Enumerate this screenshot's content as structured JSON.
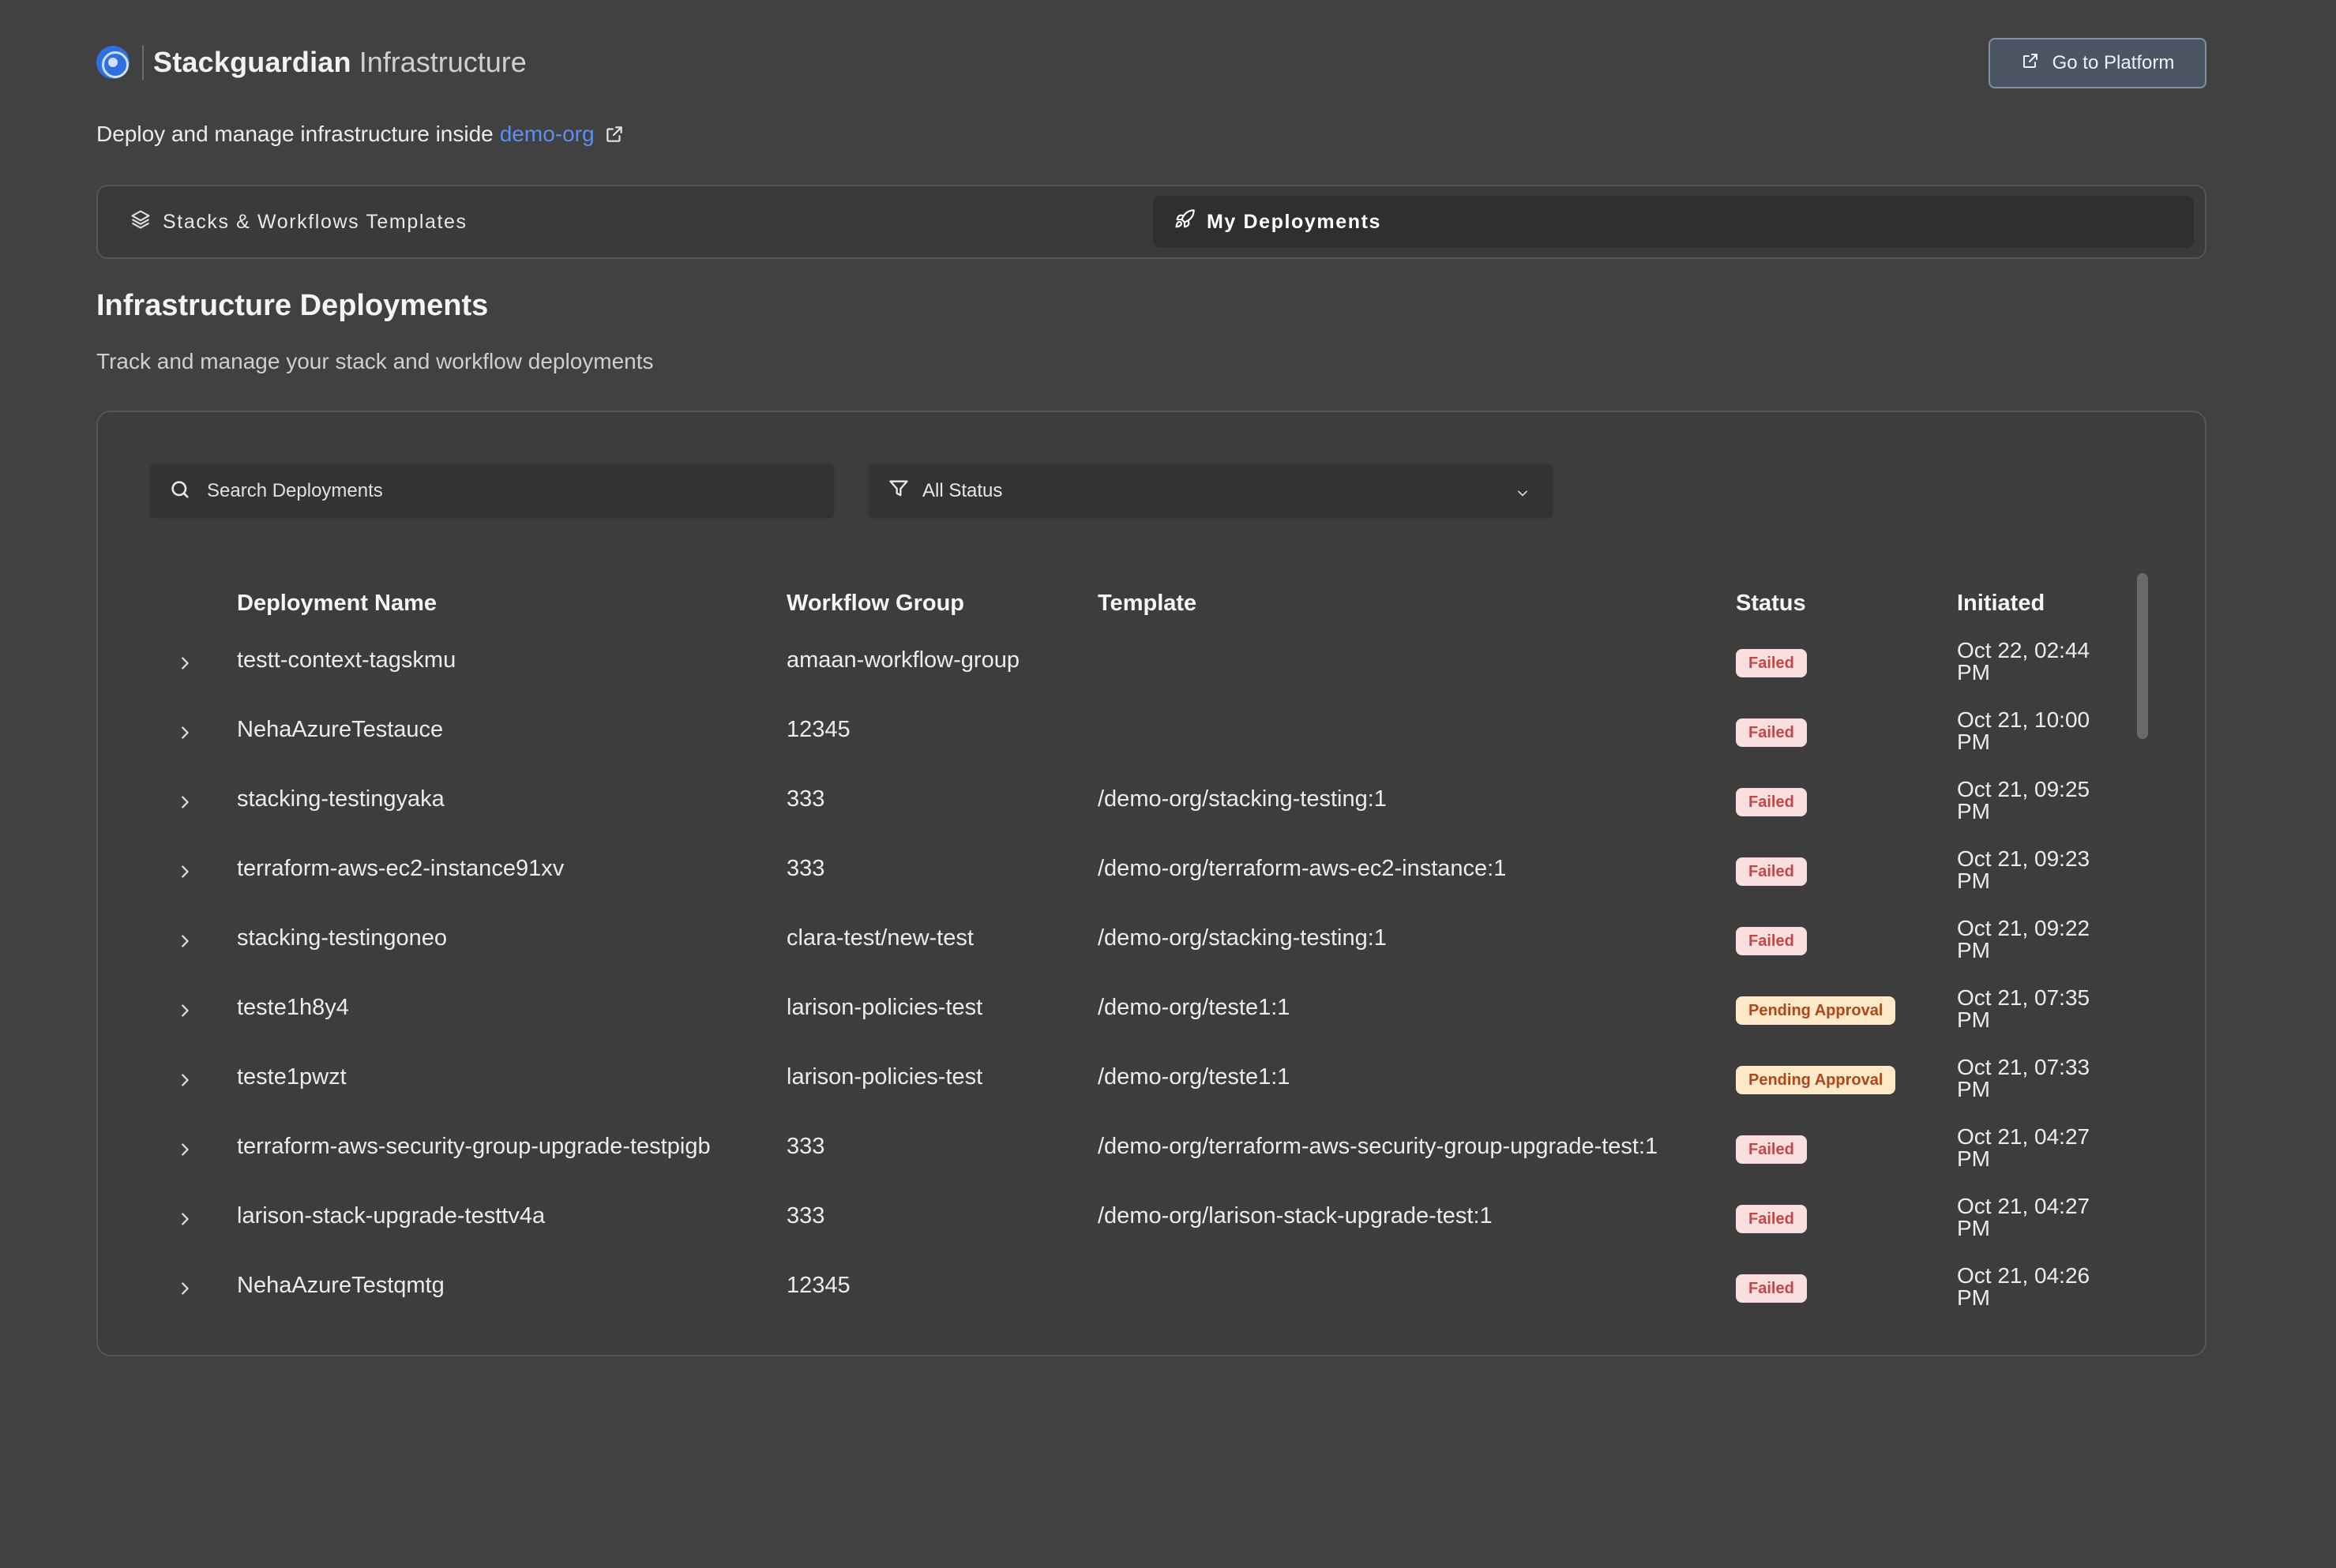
{
  "header": {
    "brand": "Stackguardian",
    "brand_sub": "Infrastructure",
    "go_to_platform": "Go to Platform"
  },
  "subtitle": {
    "text": "Deploy and manage infrastructure inside",
    "org": "demo-org"
  },
  "tabs": [
    {
      "label": "Stacks & Workflows Templates",
      "icon": "layers-icon",
      "active": false
    },
    {
      "label": "My Deployments",
      "icon": "rocket-icon",
      "active": true
    }
  ],
  "section": {
    "title": "Infrastructure Deployments",
    "description": "Track and manage your stack and workflow deployments"
  },
  "filters": {
    "search_placeholder": "Search Deployments",
    "status_value": "All Status"
  },
  "table": {
    "columns": [
      "Deployment Name",
      "Workflow Group",
      "Template",
      "Status",
      "Initiated"
    ],
    "rows": [
      {
        "name": "testt-context-tagskmu",
        "group": "amaan-workflow-group",
        "template": "",
        "status": "Failed",
        "date": "Oct 22, 02:44",
        "ampm": "PM"
      },
      {
        "name": "NehaAzureTestauce",
        "group": "12345",
        "template": "",
        "status": "Failed",
        "date": "Oct 21, 10:00",
        "ampm": "PM"
      },
      {
        "name": "stacking-testingyaka",
        "group": "333",
        "template": "/demo-org/stacking-testing:1",
        "status": "Failed",
        "date": "Oct 21, 09:25",
        "ampm": "PM"
      },
      {
        "name": "terraform-aws-ec2-instance91xv",
        "group": "333",
        "template": "/demo-org/terraform-aws-ec2-instance:1",
        "status": "Failed",
        "date": "Oct 21, 09:23",
        "ampm": "PM"
      },
      {
        "name": "stacking-testingoneo",
        "group": "clara-test/new-test",
        "template": "/demo-org/stacking-testing:1",
        "status": "Failed",
        "date": "Oct 21, 09:22",
        "ampm": "PM"
      },
      {
        "name": "teste1h8y4",
        "group": "larison-policies-test",
        "template": "/demo-org/teste1:1",
        "status": "Pending Approval",
        "date": "Oct 21, 07:35",
        "ampm": "PM"
      },
      {
        "name": "teste1pwzt",
        "group": "larison-policies-test",
        "template": "/demo-org/teste1:1",
        "status": "Pending Approval",
        "date": "Oct 21, 07:33",
        "ampm": "PM"
      },
      {
        "name": "terraform-aws-security-group-upgrade-testpigb",
        "group": "333",
        "template": "/demo-org/terraform-aws-security-group-upgrade-test:1",
        "status": "Failed",
        "date": "Oct 21, 04:27",
        "ampm": "PM"
      },
      {
        "name": "larison-stack-upgrade-testtv4a",
        "group": "333",
        "template": "/demo-org/larison-stack-upgrade-test:1",
        "status": "Failed",
        "date": "Oct 21, 04:27",
        "ampm": "PM"
      },
      {
        "name": "NehaAzureTestqmtg",
        "group": "12345",
        "template": "",
        "status": "Failed",
        "date": "Oct 21, 04:26",
        "ampm": "PM"
      }
    ]
  },
  "colors": {
    "background": "#414141",
    "accent_link": "#5b8ff0",
    "failed_badge_bg": "#fbdede",
    "failed_badge_text": "#c64545",
    "pending_badge_bg": "#fde8c8",
    "pending_badge_text": "#b0461c"
  }
}
